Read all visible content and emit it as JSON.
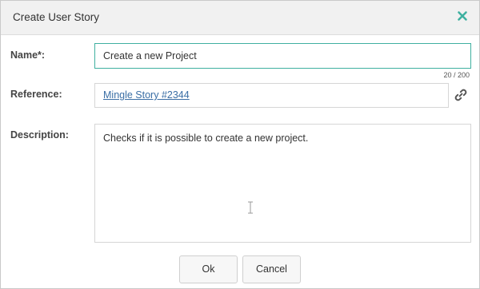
{
  "dialog": {
    "title": "Create User Story",
    "close_icon": "close-icon",
    "accent_color": "#3fb0a0"
  },
  "form": {
    "name": {
      "label": "Name*:",
      "value": "Create a new Project",
      "counter": "20 / 200"
    },
    "reference": {
      "label": "Reference:",
      "link_text": "Mingle Story #2344",
      "icon": "link-icon"
    },
    "description": {
      "label": "Description:",
      "value": "Checks if it is possible to create a new project."
    }
  },
  "actions": {
    "ok_label": "Ok",
    "cancel_label": "Cancel"
  }
}
